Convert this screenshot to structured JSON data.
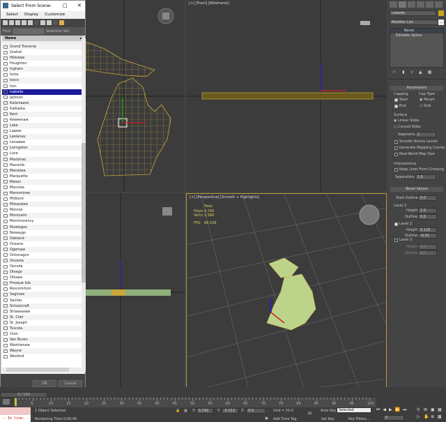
{
  "dialog": {
    "title": "Select From Scene",
    "menu": [
      "Select",
      "Display",
      "Customize"
    ],
    "find_label": "Find:",
    "find_value": "",
    "selection_set_label": "Selection Set:",
    "column_header": "Name",
    "items": [
      "Grand Traverse",
      "Gratiot",
      "Hillsdale",
      "Houghton",
      "Ingham",
      "Ionia",
      "Iosco",
      "Iron",
      "Isabella",
      "Jackson",
      "Kalamazoo",
      "Kalkaska",
      "Kent",
      "Keweenaw",
      "Lake",
      "Lapeer",
      "Leelanau",
      "Lenawee",
      "Livingston",
      "Luce",
      "Mackinac",
      "Macomb",
      "Manistee",
      "Marquette",
      "Mason",
      "Mecosta",
      "Menominee",
      "Midland",
      "Missaukee",
      "Monroe",
      "Montcalm",
      "Montmorency",
      "Muskegon",
      "Newaygo",
      "Oakland",
      "Oceana",
      "Ogemaw",
      "Ontonagon",
      "Osceola",
      "Oscoda",
      "Otsego",
      "Ottawa",
      "Presque Isle",
      "Roscommon",
      "Saginaw",
      "Sanilac",
      "Schoolcraft",
      "Shiawassee",
      "St. Clair",
      "St. Joseph",
      "Tuscola",
      "Uron",
      "Van Buren",
      "Washtenaw",
      "Wayne",
      "Wexford"
    ],
    "selected_item": "Isabella",
    "ok_label": "OK",
    "cancel_label": "Cancel"
  },
  "viewports": {
    "front_label": "[+] [Front] [Wireframe]",
    "perspective_label": "[+] [Perspective] [Smooth + Highlights]",
    "stats": {
      "total_label": "Total",
      "polys_label": "Polys:",
      "polys": "4,760",
      "verts_label": "Verts:",
      "verts": "2,990",
      "fps_label": "FPS:",
      "fps": "86.528"
    }
  },
  "command_panel": {
    "object_name": "Isabella",
    "object_color": "#c8a820",
    "modifier_list": "Modifier List",
    "stack": [
      "Bevel",
      "Editable Spline"
    ],
    "parameters": {
      "title": "Parameters",
      "capping_label": "Capping",
      "start_label": "Start",
      "start_checked": true,
      "end_label": "End",
      "end_checked": true,
      "cap_type_label": "Cap Type",
      "morph_label": "Morph",
      "grid_label": "Grid",
      "cap_type": "Morph",
      "surface_label": "Surface",
      "linear_sides": "Linear Sides",
      "curved_sides": "Curved Sides",
      "surface": "Linear Sides",
      "segments_label": "Segments:",
      "segments": "1",
      "smooth_across": "Smooth Across Levels",
      "gen_mapping": "Generate Mapping Coords.",
      "real_world": "Real-World Map Size",
      "intersections_label": "Intersections",
      "keep_lines": "Keep Lines From Crossing",
      "separation_label": "Separation:",
      "separation": "1.0"
    },
    "bevel_values": {
      "title": "Bevel Values",
      "start_outline_label": "Start Outline:",
      "start_outline": "0.0",
      "level1_label": "Level 1:",
      "height_label": "Height:",
      "outline_label": "Outline:",
      "l1_height": "1.0",
      "l1_outline": "0.0",
      "level2_label": "Level 2:",
      "level2_checked": true,
      "l2_height": "0.125",
      "l2_outline": "-0.01",
      "level3_label": "Level 3:",
      "level3_checked": false,
      "l3_height": "0.0",
      "l3_outline": "0.0"
    }
  },
  "timeline": {
    "frame_readout": "0 / 100",
    "ticks": [
      "5",
      "10",
      "15",
      "20",
      "25",
      "30",
      "35",
      "40",
      "45",
      "50",
      "55",
      "60",
      "65",
      "70",
      "75",
      "80",
      "85",
      "90",
      "95",
      "100"
    ]
  },
  "status": {
    "script_text": "-- In line:",
    "selection": "1 Object Selected",
    "render_time": "Rendering Time  0:00:46",
    "x_label": "X:",
    "x": "5.742",
    "y_label": "Y:",
    "y": "-5.213",
    "z_label": "Z:",
    "z": "0.0",
    "grid": "Grid = 10.0",
    "add_time_tag": "Add Time Tag",
    "auto_key": "Auto Key",
    "set_key": "Set Key",
    "key_mode": "Selected",
    "key_filters": "Key Filters...",
    "current_frame": "0"
  }
}
